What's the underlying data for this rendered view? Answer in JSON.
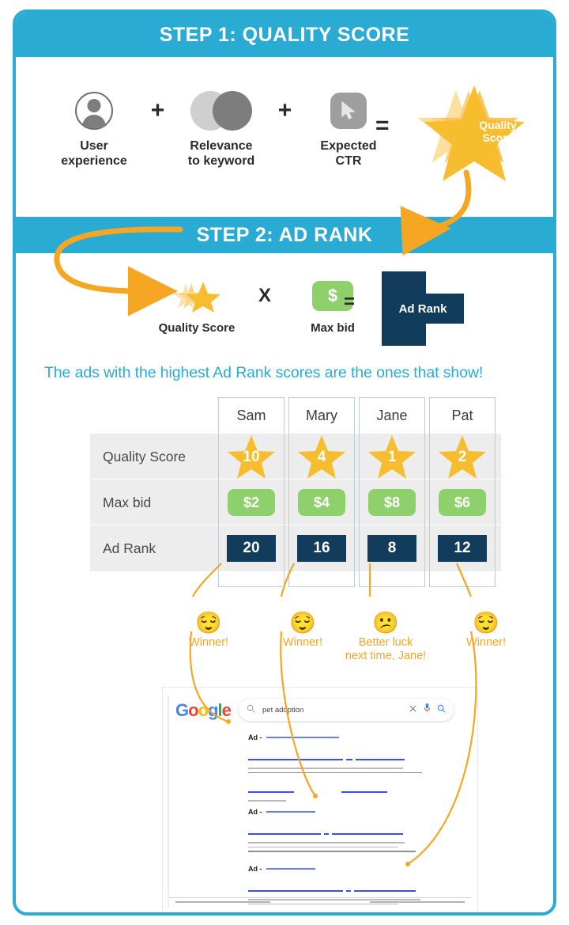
{
  "theme": {
    "blue": "#29abd4",
    "orange": "#f5a623",
    "yellow": "#f6bd2f",
    "green": "#8ed06b",
    "navy": "#113c5c",
    "gray_band": "#ededed"
  },
  "step1": {
    "header": "STEP 1: QUALITY SCORE",
    "factors": [
      {
        "icon": "user-avatar-icon",
        "label_line1": "User",
        "label_line2": "experience"
      },
      {
        "icon": "venn-overlap-icon",
        "label_line1": "Relevance",
        "label_line2": "to keyword"
      },
      {
        "icon": "cursor-click-icon",
        "label_line1": "Expected",
        "label_line2": "CTR"
      }
    ],
    "plus": "+",
    "equals": "=",
    "result": {
      "icon": "quality-score-star-icon",
      "line1": "Quality",
      "line2": "Score"
    }
  },
  "step2": {
    "header": "STEP 2: AD RANK",
    "terms": [
      {
        "icon": "quality-score-star-small-icon",
        "label": "Quality Score"
      },
      {
        "icon": "dollar-money-icon",
        "glyph": "$",
        "label": "Max bid"
      }
    ],
    "times": "X",
    "equals": "=",
    "result_label": "Ad Rank",
    "tagline": "The ads with the highest Ad Rank scores are the ones that show!"
  },
  "table": {
    "columns": [
      "Sam",
      "Mary",
      "Jane",
      "Pat"
    ],
    "rows": [
      {
        "label": "Quality Score",
        "type": "star",
        "values": [
          "10",
          "4",
          "1",
          "2"
        ]
      },
      {
        "label": "Max bid",
        "type": "chip",
        "values": [
          "$2",
          "$4",
          "$8",
          "$6"
        ]
      },
      {
        "label": "Ad Rank",
        "type": "rank",
        "values": [
          "20",
          "16",
          "8",
          "12"
        ]
      }
    ]
  },
  "reactions": [
    {
      "face": "😌",
      "emoji_name": "relieved-face",
      "text": "Winner!"
    },
    {
      "face": "😌",
      "emoji_name": "relieved-face",
      "text": "Winner!"
    },
    {
      "face": "😕",
      "emoji_name": "confused-face",
      "text": "Better luck\nnext time, Jane!"
    },
    {
      "face": "😌",
      "emoji_name": "relieved-face",
      "text": "Winner!"
    }
  ],
  "serp": {
    "logo_letters": [
      "G",
      "o",
      "o",
      "g",
      "l",
      "e"
    ],
    "search_query": "pet adoption",
    "search_placeholder": "Search",
    "ad_label": "Ad -",
    "ads_count": 3
  }
}
